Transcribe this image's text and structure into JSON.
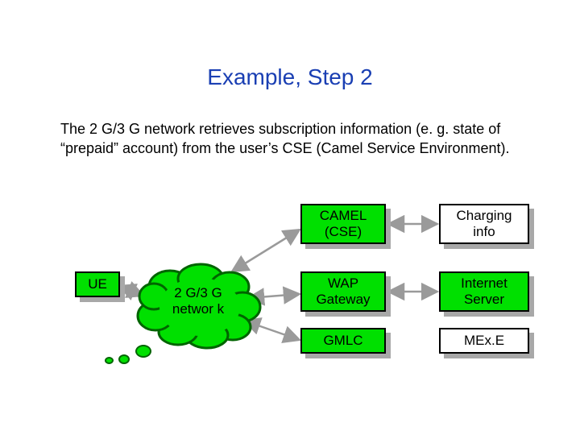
{
  "title": "Example, Step 2",
  "paragraph": "The 2 G/3 G network retrieves subscription information (e. g. state of “prepaid” account) from the user’s CSE (Camel Service Environment).",
  "nodes": {
    "ue": "UE",
    "network": "2 G/3 G networ k",
    "camel": "CAMEL\n(CSE)",
    "wap": "WAP\nGateway",
    "gmlc": "GMLC",
    "charging": "Charging\ninfo",
    "internet": "Internet\nServer",
    "mexe": "MEx.E"
  },
  "colors": {
    "green": "#00e000",
    "arrow": "#9a9a9a",
    "cloud_stroke": "#006400",
    "cloud_fill": "#00e000"
  },
  "chart_data": {
    "type": "diagram",
    "title": "Example, Step 2",
    "nodes": [
      {
        "id": "UE",
        "label": "UE",
        "style": "green-box"
      },
      {
        "id": "NET",
        "label": "2G/3G network",
        "style": "cloud"
      },
      {
        "id": "CAMEL",
        "label": "CAMEL (CSE)",
        "style": "green-box"
      },
      {
        "id": "WAP",
        "label": "WAP Gateway",
        "style": "green-box"
      },
      {
        "id": "GMLC",
        "label": "GMLC",
        "style": "green-box"
      },
      {
        "id": "CHARGING",
        "label": "Charging info",
        "style": "white-box"
      },
      {
        "id": "INTERNET",
        "label": "Internet Server",
        "style": "green-box"
      },
      {
        "id": "MEXE",
        "label": "MExE",
        "style": "white-box"
      }
    ],
    "edges": [
      {
        "from": "UE",
        "to": "NET",
        "dir": "both"
      },
      {
        "from": "NET",
        "to": "CAMEL",
        "dir": "both"
      },
      {
        "from": "NET",
        "to": "WAP",
        "dir": "both"
      },
      {
        "from": "NET",
        "to": "GMLC",
        "dir": "both"
      },
      {
        "from": "CAMEL",
        "to": "CHARGING",
        "dir": "both"
      },
      {
        "from": "WAP",
        "to": "INTERNET",
        "dir": "both"
      },
      {
        "from": "GMLC",
        "to": "MEXE",
        "dir": "none"
      }
    ],
    "annotation": "The 2G/3G network retrieves subscription information (e.g. state of “prepaid” account) from the user’s CSE (Camel Service Environment)."
  }
}
